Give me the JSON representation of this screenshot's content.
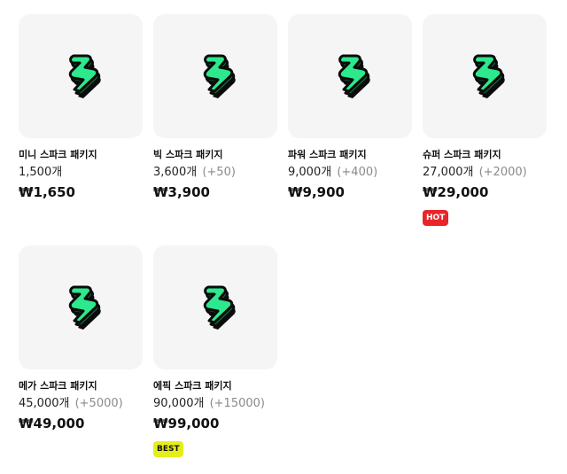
{
  "icon": "lightning-bolt-icon",
  "colors": {
    "bolt_face": "#2de88c",
    "bolt_side": "#0f6e3b",
    "bolt_outline": "#0b0b0b",
    "card_bg": "#f5f5f5",
    "hot_badge": "#e8262a",
    "best_badge": "#e5ee1a"
  },
  "packages": [
    {
      "name": "미니 스파크 패키지",
      "quantity": "1,500개",
      "bonus": "",
      "price": "₩1,650",
      "badge": ""
    },
    {
      "name": "빅 스파크 패키지",
      "quantity": "3,600개",
      "bonus": "(+50)",
      "price": "₩3,900",
      "badge": ""
    },
    {
      "name": "파워 스파크 패키지",
      "quantity": "9,000개",
      "bonus": "(+400)",
      "price": "₩9,900",
      "badge": ""
    },
    {
      "name": "슈퍼 스파크 패키지",
      "quantity": "27,000개",
      "bonus": "(+2000)",
      "price": "₩29,000",
      "badge": "HOT"
    },
    {
      "name": "메가 스파크 패키지",
      "quantity": "45,000개",
      "bonus": "(+5000)",
      "price": "₩49,000",
      "badge": ""
    },
    {
      "name": "에픽 스파크 패키지",
      "quantity": "90,000개",
      "bonus": "(+15000)",
      "price": "₩99,000",
      "badge": "BEST"
    }
  ]
}
